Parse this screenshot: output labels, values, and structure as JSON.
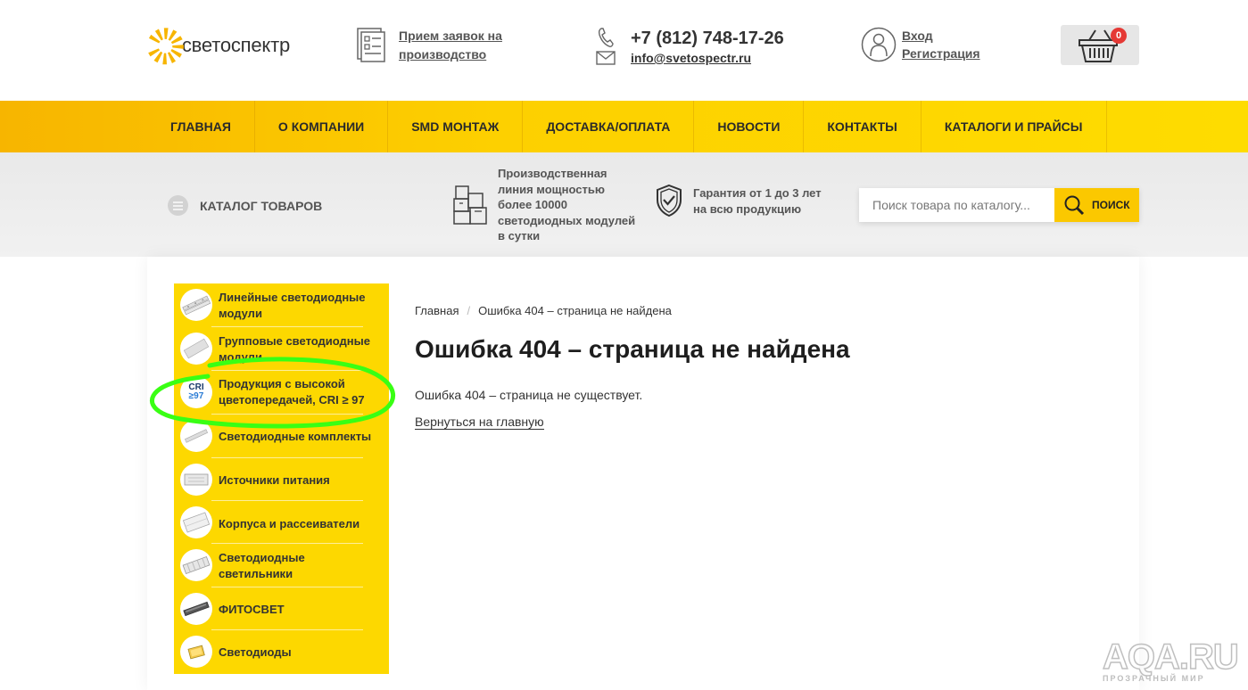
{
  "header": {
    "logo_text": "светоспектр",
    "orders_link": [
      "Прием заявок на",
      "производство"
    ],
    "phone": "+7 (812) 748-17-26",
    "email": "info@svetospectr.ru",
    "login": "Вход",
    "register": "Регистрация",
    "cart_count": "0"
  },
  "nav": {
    "items": [
      "ГЛАВНАЯ",
      "О КОМПАНИИ",
      "SMD МОНТАЖ",
      "ДОСТАВКА/ОПЛАТА",
      "НОВОСТИ",
      "КОНТАКТЫ",
      "КАТАЛОГИ И ПРАЙСЫ"
    ]
  },
  "strip": {
    "catalog_label": "КАТАЛОГ ТОВАРОВ",
    "feature_production": [
      "Производственная",
      "линия мощностью",
      "более 10000",
      "светодиодных модулей",
      "в сутки"
    ],
    "feature_guarantee": [
      "Гарантия от 1 до 3 лет",
      "на всю продукцию"
    ],
    "search_placeholder": "Поиск товара по каталогу...",
    "search_button": "ПОИСК"
  },
  "sidebar": {
    "items": [
      {
        "label": [
          "Линейные светодиодные",
          "модули"
        ]
      },
      {
        "label": [
          "Групповые светодиодные",
          "модули"
        ]
      },
      {
        "label": [
          "Продукция с высокой",
          "цветопередачей, CRI ≥ 97"
        ],
        "badge_top": "CRI",
        "badge_bottom": "≥97"
      },
      {
        "label": [
          "Светодиодные комплекты"
        ]
      },
      {
        "label": [
          "Источники питания"
        ]
      },
      {
        "label": [
          "Корпуса и рассеиватели"
        ]
      },
      {
        "label": [
          "Светодиодные",
          "светильники"
        ]
      },
      {
        "label": [
          "ФИТОСВЕТ"
        ]
      },
      {
        "label": [
          "Светодиоды"
        ]
      }
    ]
  },
  "main": {
    "breadcrumb_home": "Главная",
    "breadcrumb_sep": "/",
    "breadcrumb_current": "Ошибка 404 – страница не найдена",
    "title": "Ошибка 404 – страница не найдена",
    "text": "Ошибка 404 – страница не существует.",
    "back_link": "Вернуться на главную"
  },
  "watermark": {
    "big": "AQA.RU",
    "small": "ПРОЗРАЧНЫЙ МИР"
  },
  "colors": {
    "accent_yellow": "#fdd800",
    "highlight_green": "#39ff14",
    "badge_red": "#e53935"
  }
}
